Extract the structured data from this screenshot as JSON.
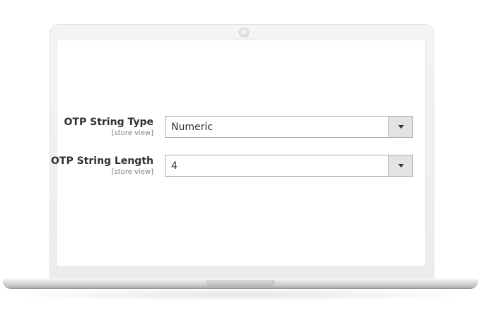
{
  "form": {
    "fields": [
      {
        "label": "OTP String Type",
        "scope": "[store view]",
        "value": "Numeric",
        "icon": "chevron-down-icon"
      },
      {
        "label": "OTP String Length",
        "scope": "[store view]",
        "value": "4",
        "icon": "chevron-down-icon"
      }
    ]
  },
  "colors": {
    "label": "#303030",
    "scope": "#808080",
    "select_border": "#adadad",
    "arrow_bg": "#e3e3e3",
    "laptop_bezel": "#f0f0f0"
  }
}
